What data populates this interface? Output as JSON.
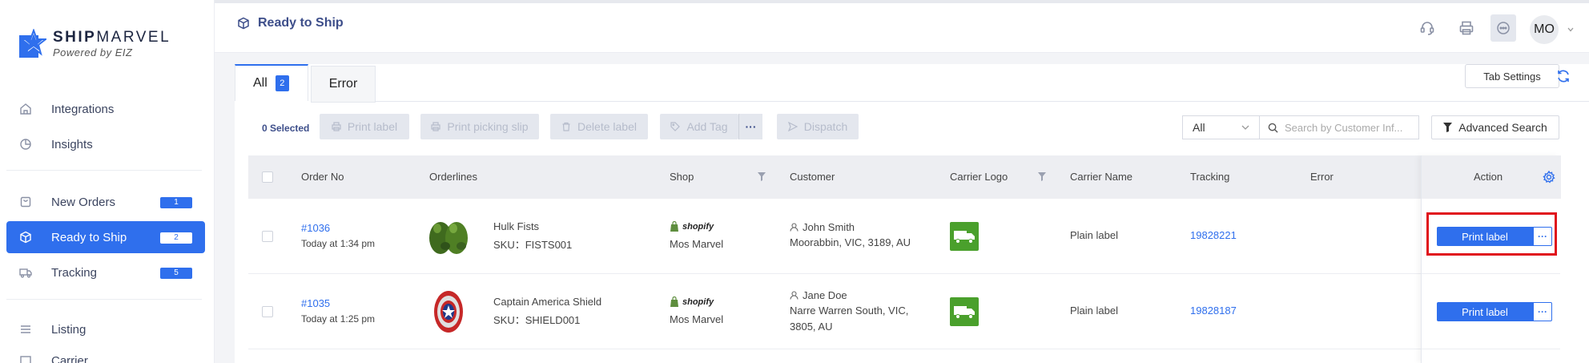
{
  "brand": {
    "name_bold": "SHIP",
    "name_rest": "MARVEL",
    "tagline": "Powered by EIZ"
  },
  "sidebar": {
    "items": [
      {
        "label": "Integrations",
        "icon": "home-icon"
      },
      {
        "label": "Insights",
        "icon": "pie-chart-icon"
      },
      {
        "label": "New Orders",
        "icon": "bag-icon",
        "badge": "1"
      },
      {
        "label": "Ready to Ship",
        "icon": "box-icon",
        "badge": "2",
        "active": true
      },
      {
        "label": "Tracking",
        "icon": "truck-icon",
        "badge": "5"
      },
      {
        "label": "Listing",
        "icon": "list-icon"
      },
      {
        "label": "Carrier",
        "icon": "carrier-icon"
      }
    ]
  },
  "header": {
    "title": "Ready to Ship",
    "avatar_initials": "MO"
  },
  "tabs": {
    "all_label": "All",
    "all_count": "2",
    "error_label": "Error",
    "settings_label": "Tab Settings"
  },
  "toolbar": {
    "selected_text": "0 Selected",
    "print_label": "Print label",
    "print_picking_slip": "Print picking slip",
    "delete_label": "Delete label",
    "add_tag": "Add Tag",
    "more": "···",
    "dispatch": "Dispatch",
    "filter_select_value": "All",
    "search_placeholder": "Search by Customer Inf...",
    "advanced_search": "Advanced Search"
  },
  "table": {
    "columns": {
      "order_no": "Order No",
      "orderlines": "Orderlines",
      "shop": "Shop",
      "customer": "Customer",
      "carrier_logo": "Carrier Logo",
      "carrier_name": "Carrier Name",
      "tracking": "Tracking",
      "error": "Error",
      "action": "Action"
    },
    "rows": [
      {
        "order_no": "#1036",
        "time": "Today at 1:34 pm",
        "product": "Hulk Fists",
        "sku": "SKU：FISTS001",
        "shop_platform": "shopify",
        "shop": "Mos Marvel",
        "customer": "John Smith",
        "address_line1": "Moorabbin, VIC, 3189, AU",
        "address_line2": "",
        "carrier": "Plain label",
        "tracking": "19828221",
        "action": "Print label",
        "action_more": "···"
      },
      {
        "order_no": "#1035",
        "time": "Today at 1:25 pm",
        "product": "Captain America Shield",
        "sku": "SKU：SHIELD001",
        "shop_platform": "shopify",
        "shop": "Mos Marvel",
        "customer": "Jane Doe",
        "address_line1": "Narre Warren South, VIC,",
        "address_line2": "3805, AU",
        "carrier": "Plain label",
        "tracking": "19828187",
        "action": "Print label",
        "action_more": "···"
      }
    ]
  },
  "colors": {
    "primary": "#2f6fed",
    "highlight": "#e0121c",
    "carrier_green": "#4aa02c"
  }
}
